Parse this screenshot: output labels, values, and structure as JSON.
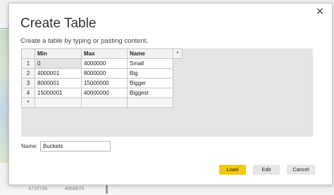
{
  "dialog": {
    "title": "Create Table",
    "subtitle": "Create a table by typing or pasting content.",
    "close_glyph": "✕"
  },
  "grid": {
    "headers": [
      "Min",
      "Max",
      "Name"
    ],
    "add_column_glyph": "*",
    "new_row_glyph": "*",
    "rows": [
      {
        "num": "1",
        "min": "0",
        "max": "4000000",
        "name": "Small"
      },
      {
        "num": "2",
        "min": "4000001",
        "max": "8000000",
        "name": "Big"
      },
      {
        "num": "3",
        "min": "8000001",
        "max": "15000000",
        "name": "Bigger"
      },
      {
        "num": "4",
        "min": "15000001",
        "max": "40000000",
        "name": "Biggest"
      }
    ]
  },
  "name_field": {
    "label": "Name:",
    "value": "Buckets"
  },
  "buttons": {
    "load": "Load",
    "edit": "Edit",
    "cancel": "Cancel"
  },
  "background": {
    "bottom_left": "4720736",
    "bottom_right": "4858870"
  },
  "colors": {
    "load_button": "#f2c811",
    "secondary_button": "#e6e6e6",
    "grid_background": "#e5e5e5"
  }
}
